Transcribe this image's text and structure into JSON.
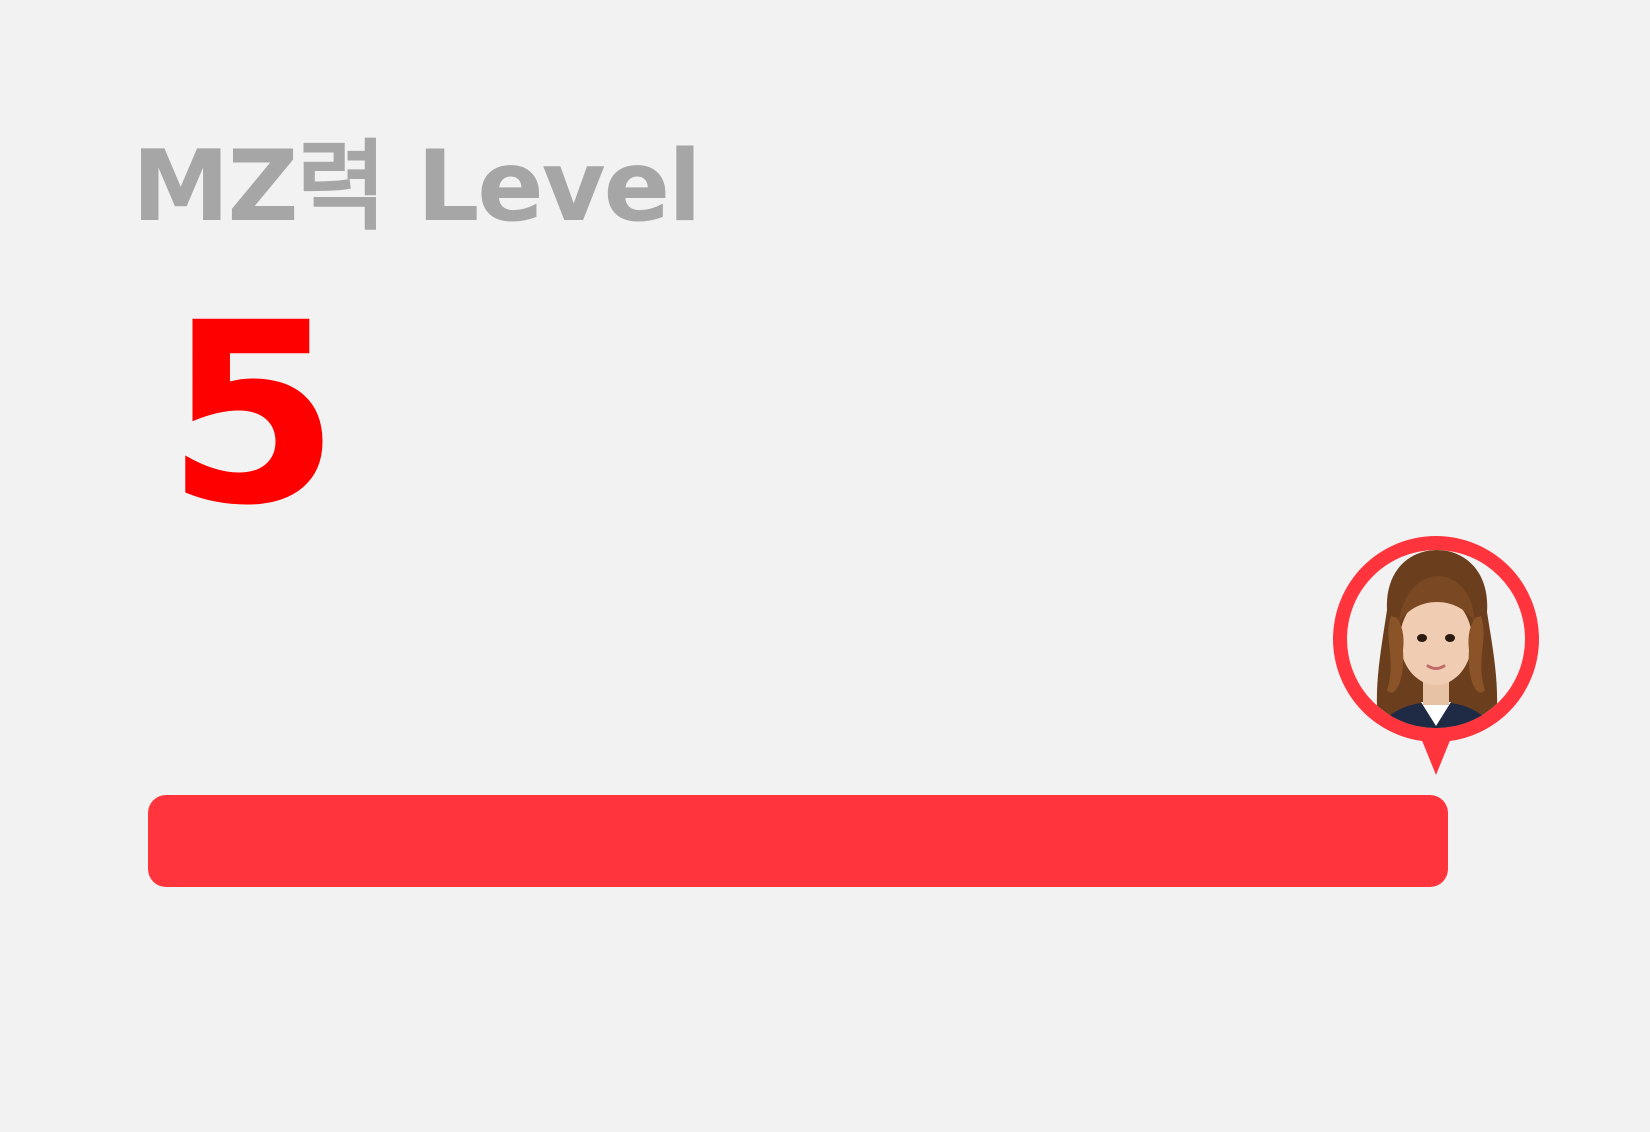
{
  "header": {
    "title": "MZ력 Level"
  },
  "level": {
    "value": "5"
  },
  "progress": {
    "fraction": 1.0,
    "color": "#ff343c"
  },
  "avatar": {
    "icon": "user-avatar-photo",
    "ring_color": "#ff343c"
  },
  "colors": {
    "background": "#f2f2f2",
    "title": "#a6a6a6",
    "level_number": "#ff0000"
  }
}
